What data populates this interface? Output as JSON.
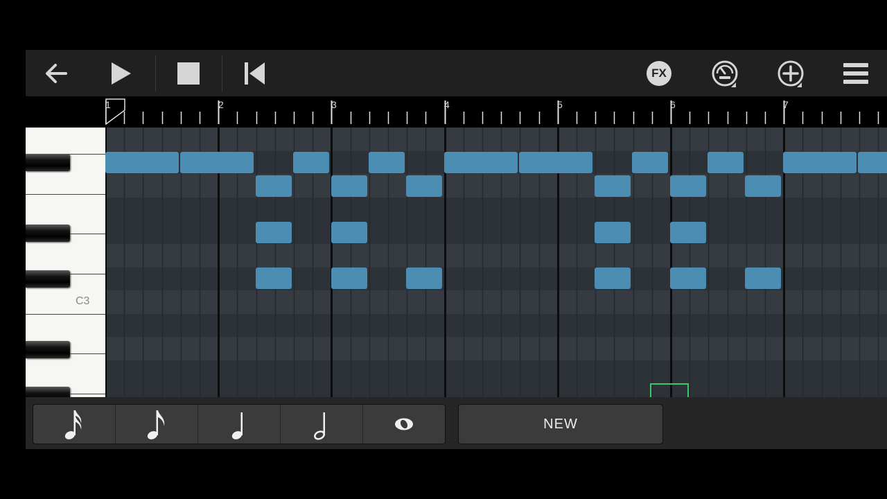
{
  "toolbar": {
    "left_buttons": [
      "back-arrow-icon",
      "play-icon",
      "stop-icon",
      "skip-to-start-icon"
    ],
    "fx_label": "FX",
    "right_buttons": [
      "fx-icon",
      "tempo-metronome-icon",
      "add-track-icon",
      "menu-icon"
    ]
  },
  "ruler": {
    "bar_numbers": [
      "1",
      "2",
      "3",
      "4",
      "5",
      "6",
      "7"
    ]
  },
  "keyboard": {
    "c3_label": "C3"
  },
  "note_lengths": [
    "sixteenth-note-icon",
    "eighth-note-icon",
    "quarter-note-icon",
    "half-note-icon",
    "whole-note-icon"
  ],
  "new_button": {
    "label": "NEW"
  },
  "colors": {
    "note": "#4b8db3",
    "grid_dark": "#2c3237",
    "grid_light": "#353b40",
    "selection": "#3ac66a"
  }
}
